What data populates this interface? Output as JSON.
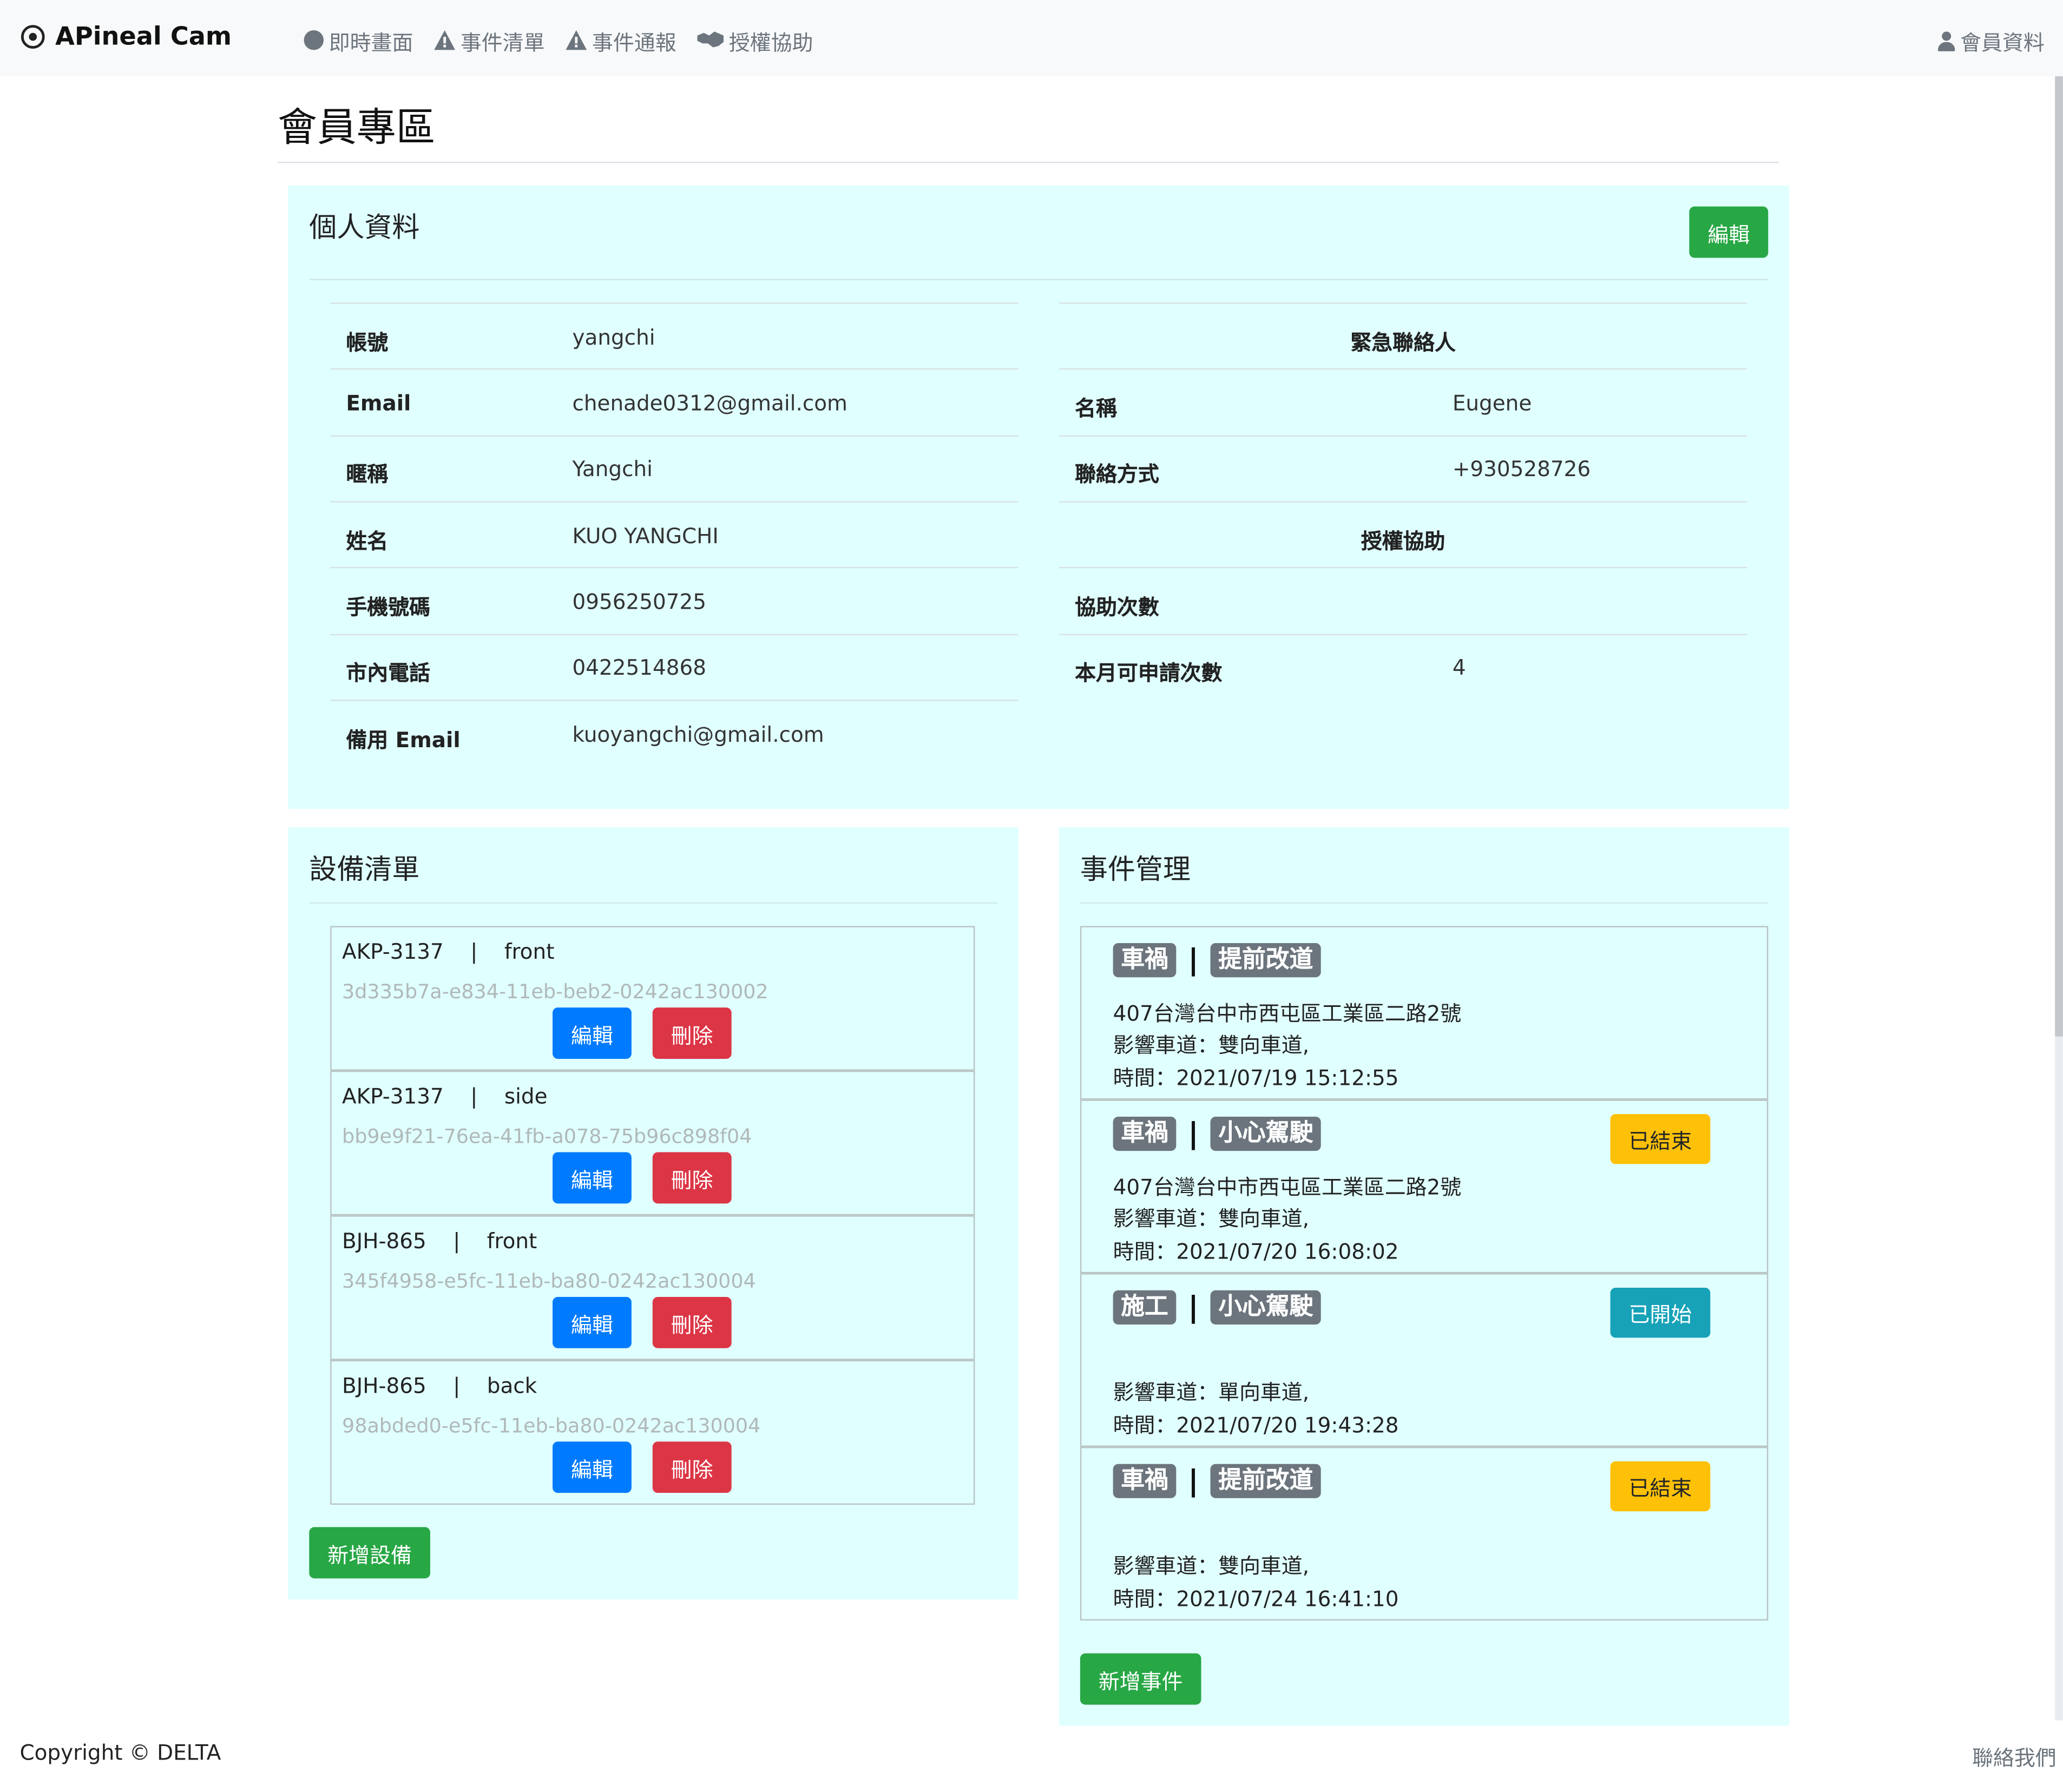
{
  "navbar": {
    "brand": "APineal Cam",
    "links": [
      {
        "label": "即時畫面",
        "icon": "circle-icon"
      },
      {
        "label": "事件清單",
        "icon": "warning-icon"
      },
      {
        "label": "事件通報",
        "icon": "warning-icon"
      },
      {
        "label": "授權協助",
        "icon": "handshake-icon"
      }
    ],
    "member": "會員資料"
  },
  "page_title": "會員專區",
  "personal": {
    "title": "個人資料",
    "edit_label": "編輯",
    "rows": [
      {
        "label": "帳號",
        "value": "yangchi"
      },
      {
        "label": "Email",
        "value": "chenade0312@gmail.com"
      },
      {
        "label": "暱稱",
        "value": "Yangchi"
      },
      {
        "label": "姓名",
        "value": "KUO YANGCHI"
      },
      {
        "label": "手機號碼",
        "value": "0956250725"
      },
      {
        "label": "市內電話",
        "value": "0422514868"
      },
      {
        "label": "備用 Email",
        "value": "kuoyangchi@gmail.com"
      }
    ],
    "emergency_heading": "緊急聯絡人",
    "emergency": [
      {
        "label": "名稱",
        "value": "Eugene"
      },
      {
        "label": "聯絡方式",
        "value": "+930528726"
      }
    ],
    "assist_heading": "授權協助",
    "assist": [
      {
        "label": "協助次數",
        "value": ""
      },
      {
        "label": "本月可申請次數",
        "value": "4"
      }
    ]
  },
  "devices": {
    "title": "設備清單",
    "items": [
      {
        "head": "AKP-3137    |    front",
        "uuid": "3d335b7a-e834-11eb-beb2-0242ac130002"
      },
      {
        "head": "AKP-3137    |    side",
        "uuid": "bb9e9f21-76ea-41fb-a078-75b96c898f04"
      },
      {
        "head": "BJH-865    |    front",
        "uuid": "345f4958-e5fc-11eb-ba80-0242ac130004"
      },
      {
        "head": "BJH-865    |    back",
        "uuid": "98abded0-e5fc-11eb-ba80-0242ac130004"
      }
    ],
    "edit_label": "編輯",
    "delete_label": "刪除",
    "add_label": "新增設備"
  },
  "events": {
    "title": "事件管理",
    "items": [
      {
        "type": "車禍",
        "action": "提前改道",
        "address": "407台灣台中市西屯區工業區二路2號",
        "lane": "影響車道：雙向車道,",
        "time": "時間：2021/07/19 15:12:55",
        "status": "",
        "status_color": ""
      },
      {
        "type": "車禍",
        "action": "小心駕駛",
        "address": "407台灣台中市西屯區工業區二路2號",
        "lane": "影響車道：雙向車道,",
        "time": "時間：2021/07/20 16:08:02",
        "status": "已結束",
        "status_color": "#ffc107"
      },
      {
        "type": "施工",
        "action": "小心駕駛",
        "address": "",
        "lane": "影響車道：單向車道,",
        "time": "時間：2021/07/20 19:43:28",
        "status": "已開始",
        "status_color": "#17a2b8"
      },
      {
        "type": "車禍",
        "action": "提前改道",
        "address": "",
        "lane": "影響車道：雙向車道,",
        "time": "時間：2021/07/24 16:41:10",
        "status": "已結束",
        "status_color": "#ffc107"
      }
    ],
    "add_label": "新增事件"
  },
  "footer": {
    "copyright": "Copyright © DELTA",
    "contact": "聯絡我們"
  },
  "colors": {
    "panel_bg": "#e0ffff",
    "success": "#28a745",
    "primary": "#007bff",
    "danger": "#dc3545",
    "warning": "#ffc107",
    "info": "#17a2b8",
    "badge": "#6c757d"
  }
}
